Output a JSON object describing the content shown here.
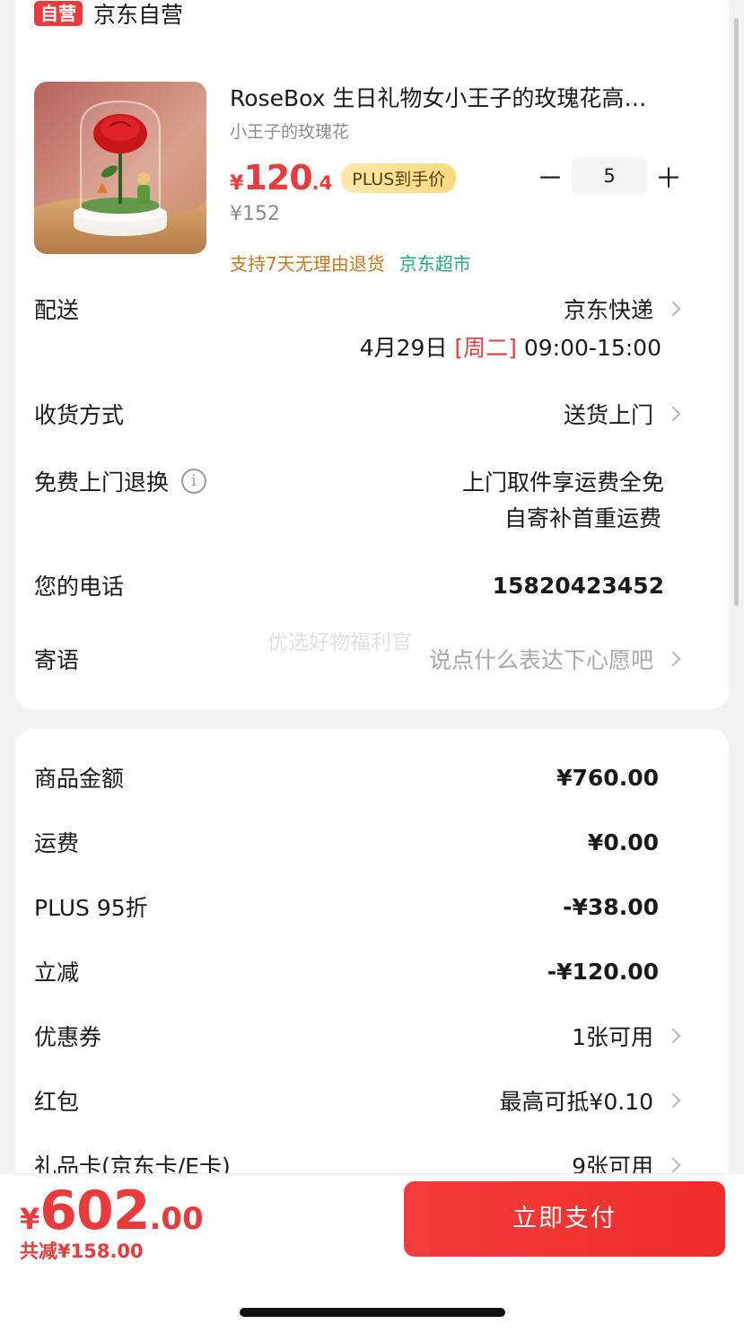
{
  "shop": {
    "badge": "自营",
    "name": "京东自营"
  },
  "product": {
    "title": "RoseBox 生日礼物女小王子的玫瑰花高…",
    "subtitle": "小王子的玫瑰花",
    "price_symbol": "¥",
    "price_int": "120",
    "price_dec": ".4",
    "plus_badge": "PLUS到手价",
    "original_price": "¥152",
    "tag_return": "支持7天无理由退货",
    "tag_market": "京东超市",
    "quantity": "5",
    "minus": "－",
    "plus": "＋"
  },
  "delivery": {
    "label": "配送",
    "carrier": "京东快递",
    "date": "4月29日",
    "weekday": "[周二]",
    "time": "09:00-15:00"
  },
  "receive": {
    "label": "收货方式",
    "value": "送货上门"
  },
  "free_return": {
    "label": "免费上门退换",
    "line1": "上门取件享运费全免",
    "line2": "自寄补首重运费"
  },
  "phone": {
    "label": "您的电话",
    "value": "15820423452"
  },
  "message": {
    "label": "寄语",
    "placeholder": "说点什么表达下心愿吧"
  },
  "watermark": "优选好物福利官",
  "summary": {
    "goods_label": "商品金额",
    "goods_value": "¥760.00",
    "shipping_label": "运费",
    "shipping_value": "¥0.00",
    "plus_label": "PLUS 95折",
    "plus_value": "-¥38.00",
    "instant_label": "立减",
    "instant_value": "-¥120.00",
    "coupon_label": "优惠券",
    "coupon_value": "1张可用",
    "redpacket_label": "红包",
    "redpacket_value": "最高可抵¥0.10",
    "giftcard_label": "礼品卡(京东卡/E卡)",
    "giftcard_value": "9张可用"
  },
  "footer": {
    "total_symbol": "¥",
    "total_int": "602",
    "total_dec": ".00",
    "saved": "共减¥158.00",
    "pay_button": "立即支付"
  },
  "colors": {
    "accent": "#e93b3b",
    "green": "#27a68a",
    "orange": "#c97820"
  }
}
